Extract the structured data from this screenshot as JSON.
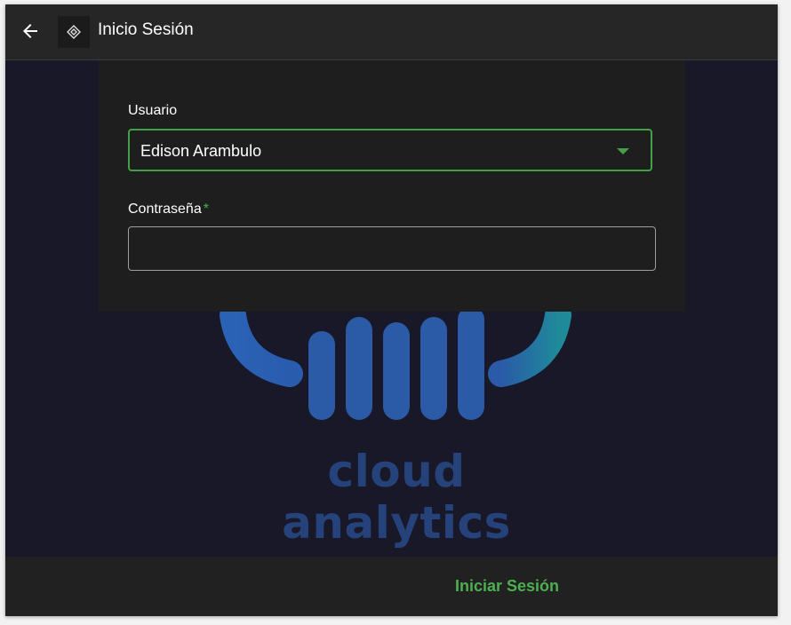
{
  "appbar": {
    "title": "Inicio Sesión",
    "back_icon": "arrow-left-icon",
    "logo_icon": "app-logo-icon"
  },
  "background": {
    "brand_text": "cloud analytics",
    "colors": {
      "primary": "#2b5aa6",
      "accent": "#1f8a9a",
      "text": "#26427a"
    }
  },
  "form": {
    "usuario_label": "Usuario",
    "usuario_value": "Edison Arambulo",
    "contrasena_label": "Contraseña",
    "required_mark": "*",
    "contrasena_value": ""
  },
  "footer": {
    "login_label": "Iniciar Sesión"
  },
  "colors": {
    "accent": "#4caf50",
    "appbar": "#262626",
    "card": "#1e1e1e",
    "background": "#181828"
  }
}
